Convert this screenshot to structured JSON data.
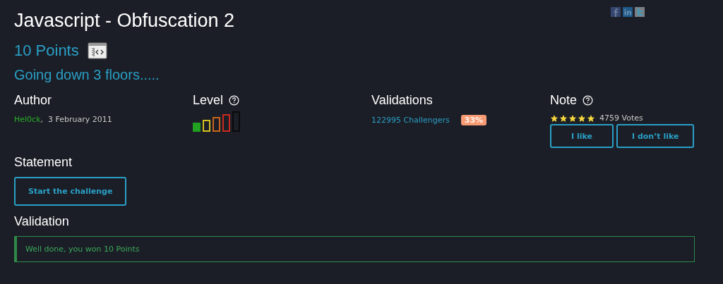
{
  "title": "Javascript - Obfuscation 2",
  "points": "10 Points",
  "subtitle": "Going down 3 floors.....",
  "author": {
    "heading": "Author",
    "name": "Hel0ck",
    "date": ",  3 February 2011"
  },
  "difficulty": {
    "heading": "Level",
    "level": 0.2
  },
  "validations": {
    "heading": "Validations",
    "challengers": "122995 Challengers",
    "rate": "33%"
  },
  "note": {
    "heading": "Note",
    "stars": 5,
    "votes": "4759 Votes",
    "buttons": [
      "I like",
      "I don’t like"
    ]
  },
  "statement": {
    "heading": "Statement",
    "button": "Start the challenge"
  },
  "validation": {
    "heading": "Validation",
    "message": "Well done, you won 10 Points"
  }
}
